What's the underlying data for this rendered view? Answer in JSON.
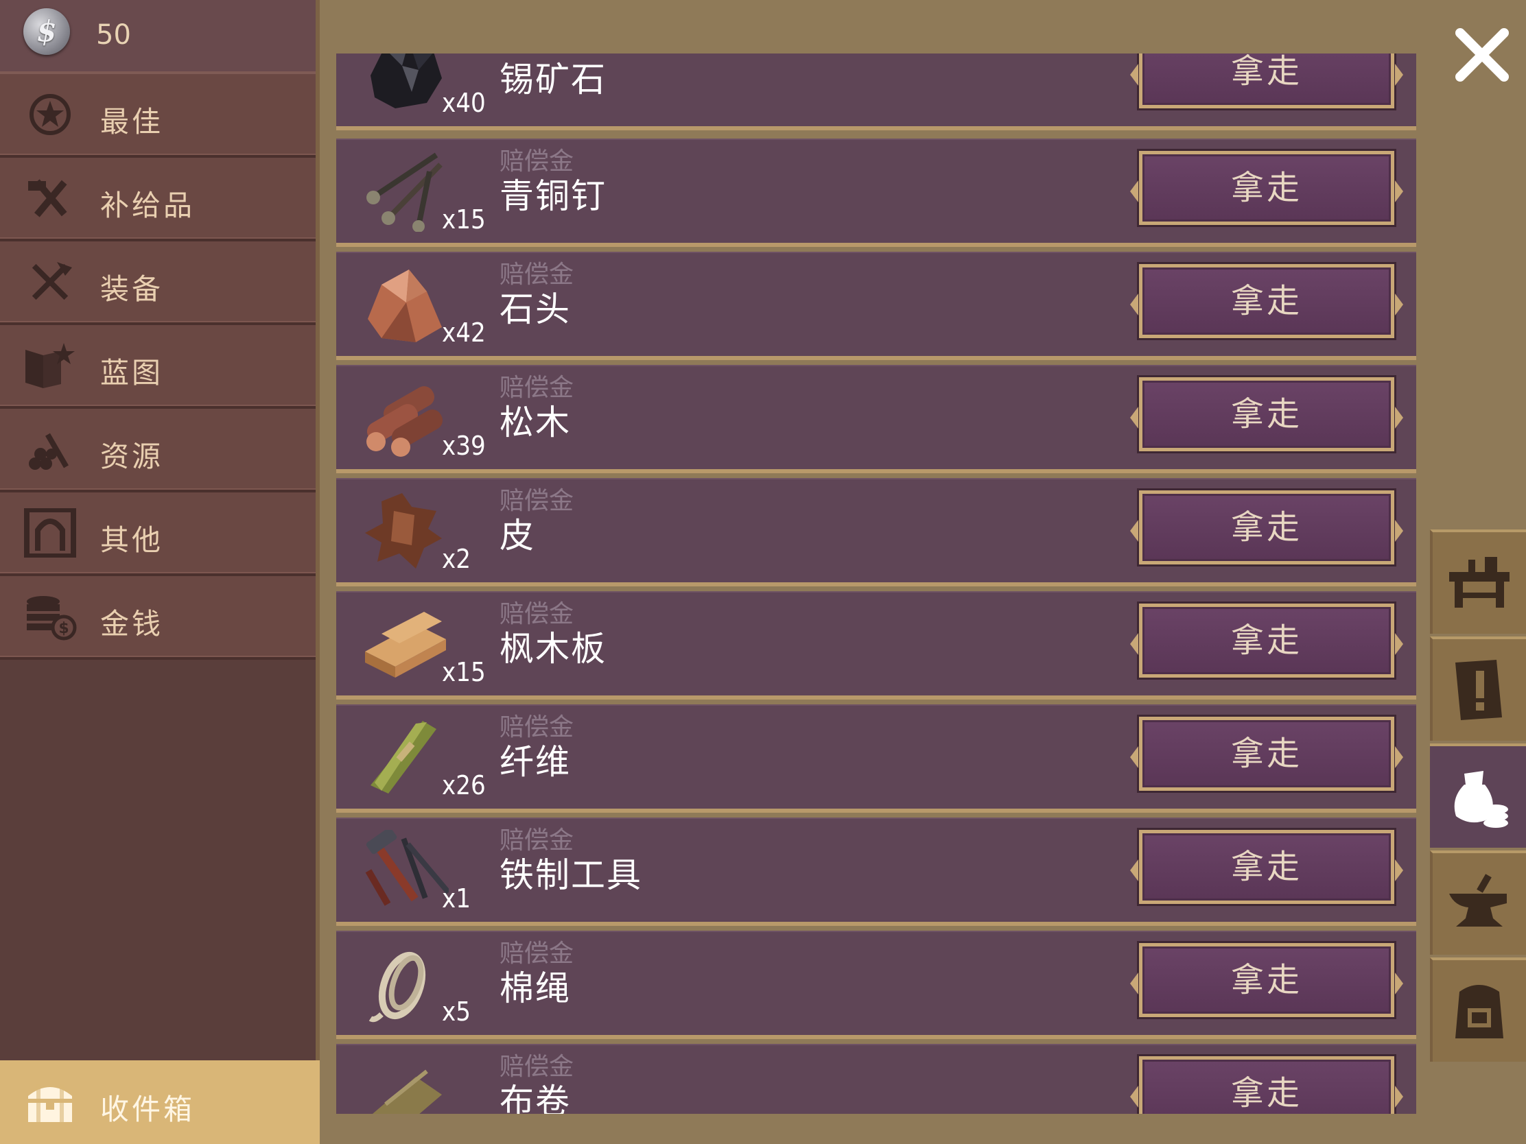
{
  "currency": {
    "value": "50",
    "icon": "silver-coin-icon"
  },
  "sidebar": {
    "items": [
      {
        "label": "最佳",
        "icon": "star-badge-icon"
      },
      {
        "label": "补给品",
        "icon": "tools-icon"
      },
      {
        "label": "装备",
        "icon": "weapons-icon"
      },
      {
        "label": "蓝图",
        "icon": "blueprint-icon"
      },
      {
        "label": "资源",
        "icon": "resources-icon"
      },
      {
        "label": "其他",
        "icon": "portrait-frame-icon"
      },
      {
        "label": "金钱",
        "icon": "coin-stack-icon"
      }
    ],
    "inbox": {
      "label": "收件箱",
      "icon": "chest-icon"
    }
  },
  "items": [
    {
      "tag": "",
      "name": "锡矿石",
      "qty": "x40",
      "icon": "tin-ore-icon",
      "button": "拿走"
    },
    {
      "tag": "赔偿金",
      "name": "青铜钉",
      "qty": "x15",
      "icon": "bronze-nails-icon",
      "button": "拿走"
    },
    {
      "tag": "赔偿金",
      "name": "石头",
      "qty": "x42",
      "icon": "stone-icon",
      "button": "拿走"
    },
    {
      "tag": "赔偿金",
      "name": "松木",
      "qty": "x39",
      "icon": "pine-logs-icon",
      "button": "拿走"
    },
    {
      "tag": "赔偿金",
      "name": "皮",
      "qty": "x2",
      "icon": "hide-icon",
      "button": "拿走"
    },
    {
      "tag": "赔偿金",
      "name": "枫木板",
      "qty": "x15",
      "icon": "maple-planks-icon",
      "button": "拿走"
    },
    {
      "tag": "赔偿金",
      "name": "纤维",
      "qty": "x26",
      "icon": "fiber-bundle-icon",
      "button": "拿走"
    },
    {
      "tag": "赔偿金",
      "name": "铁制工具",
      "qty": "x1",
      "icon": "iron-tools-icon",
      "button": "拿走"
    },
    {
      "tag": "赔偿金",
      "name": "棉绳",
      "qty": "x5",
      "icon": "cotton-rope-icon",
      "button": "拿走"
    },
    {
      "tag": "赔偿金",
      "name": "布卷",
      "qty": "",
      "icon": "cloth-roll-icon",
      "button": "拿走"
    }
  ],
  "right_tabs": [
    {
      "icon": "workbench-icon",
      "active": false
    },
    {
      "icon": "notice-icon",
      "active": false
    },
    {
      "icon": "money-bag-icon",
      "active": true
    },
    {
      "icon": "anvil-icon",
      "active": false
    },
    {
      "icon": "backpack-icon",
      "active": false
    }
  ],
  "colors": {
    "row_bg": "#5f4556",
    "button_border": "#c9a877",
    "sidebar_bg": "#6a4843",
    "inbox_bg": "#d9b677"
  }
}
